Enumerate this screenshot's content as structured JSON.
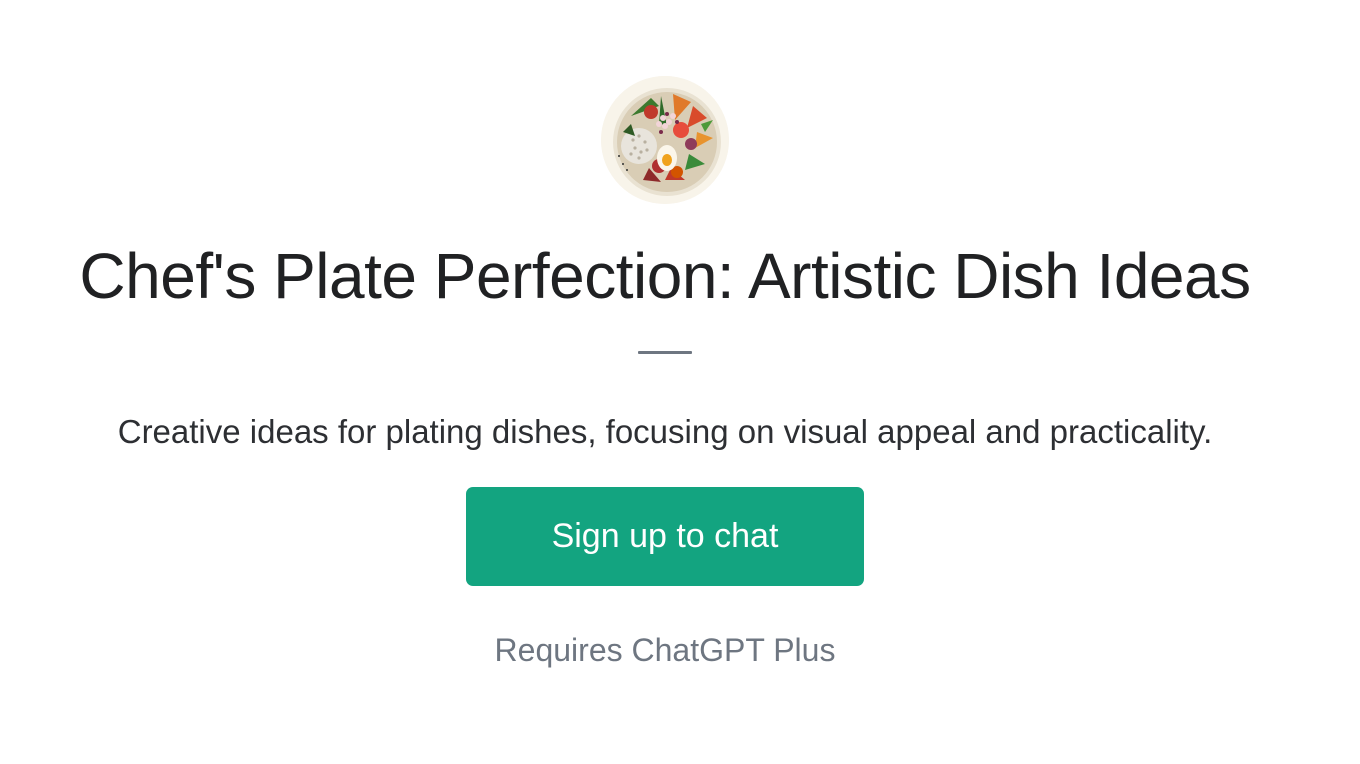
{
  "gpt": {
    "avatar_icon": "food-bowl-icon",
    "title": "Chef's Plate Perfection: Artistic Dish Ideas",
    "description": "Creative ideas for plating dishes, focusing on visual appeal and practicality."
  },
  "actions": {
    "signup_label": "Sign up to chat",
    "requirement_note": "Requires ChatGPT Plus"
  },
  "colors": {
    "accent": "#13a480",
    "title_text": "#202123",
    "muted_text": "#6e7681",
    "background": "#ffffff"
  }
}
